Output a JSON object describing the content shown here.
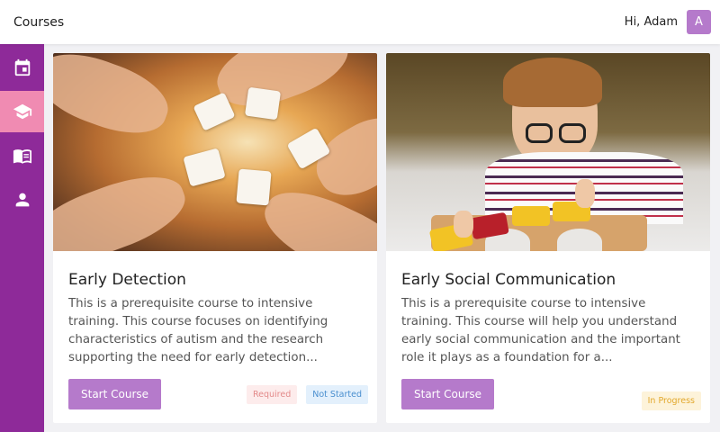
{
  "header": {
    "title": "Courses",
    "greeting": "Hi, Adam",
    "avatar_letter": "A"
  },
  "sidebar": {
    "items": [
      {
        "icon": "calendar-icon",
        "active": false
      },
      {
        "icon": "graduation-cap-icon",
        "active": true
      },
      {
        "icon": "book-icon",
        "active": false
      },
      {
        "icon": "user-icon",
        "active": false
      }
    ]
  },
  "courses": [
    {
      "title": "Early Detection",
      "description": "This is a prerequisite course to intensive training. This course focuses on identifying characteristics of autism and the research supporting the need for early detection...",
      "button_label": "Start Course",
      "badges": [
        "Required",
        "Not Started"
      ]
    },
    {
      "title": "Early Social Communication",
      "description": "This is a prerequisite course to intensive training. This course will help you understand early social communication and the important role it plays as a foundation for a...",
      "button_label": "Start Course",
      "badges": [
        "In Progress"
      ]
    }
  ],
  "colors": {
    "sidebar": "#8e2a99",
    "sidebar_active": "#f08bb2",
    "button": "#b57acb",
    "avatar": "#b57acb"
  }
}
